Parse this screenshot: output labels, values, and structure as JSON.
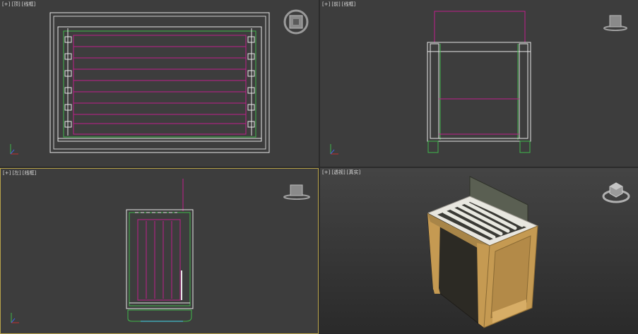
{
  "viewports": {
    "top": {
      "plus": "[+]",
      "view": "[顶]",
      "shading": "[线框]",
      "gizmo_icon": "viewcube-top-icon"
    },
    "front": {
      "plus": "[+]",
      "view": "[前]",
      "shading": "[线框]",
      "gizmo_icon": "viewcube-front-icon"
    },
    "left": {
      "plus": "[+]",
      "view": "[左]",
      "shading": "[线框]",
      "gizmo_icon": "viewcube-left-icon",
      "active": true
    },
    "perspective": {
      "plus": "[+]",
      "view": "[透视]",
      "shading": "[真实]",
      "gizmo_icon": "viewcube-perspective-icon"
    }
  },
  "colors": {
    "viewport_bg": "#3d3d3d",
    "wire_white": "#e8e8e8",
    "wire_magenta": "#c0208a",
    "wire_green": "#3fb84a",
    "active_border": "#b8a24a",
    "wood": "#c59a52"
  }
}
